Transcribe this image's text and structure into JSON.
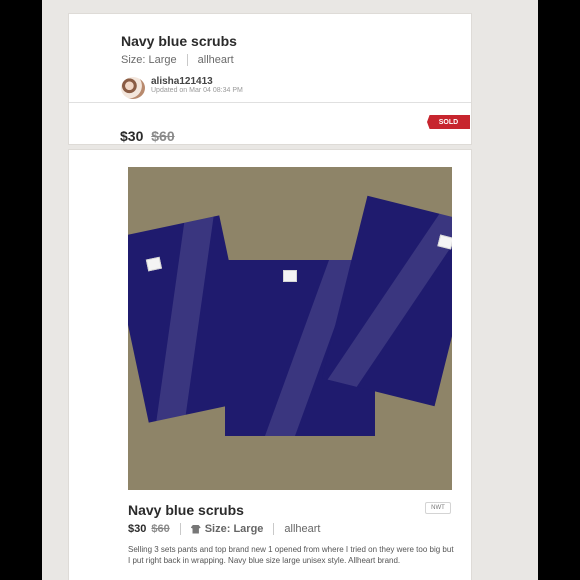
{
  "listing": {
    "title": "Navy blue scrubs",
    "size": "Size: Large",
    "brand": "allheart",
    "seller": "alisha121413",
    "updated": "Updated on Mar 04 08:34 PM",
    "price": "$30",
    "original_price": "$60",
    "status": "SOLD"
  },
  "details": {
    "title": "Navy blue scrubs",
    "condition_badge": "NWT",
    "price": "$30",
    "original_price": "$60",
    "size": "Size: Large",
    "brand": "allheart",
    "description": "Selling 3 sets pants and top brand new 1 opened from where I tried on they were too big but I put right back in wrapping. Navy blue size large unisex style. Allheart brand."
  },
  "colors": {
    "sold_tag": "#c7252e",
    "page_bg": "#e9e7e4",
    "navy": "#1f1b6e"
  }
}
